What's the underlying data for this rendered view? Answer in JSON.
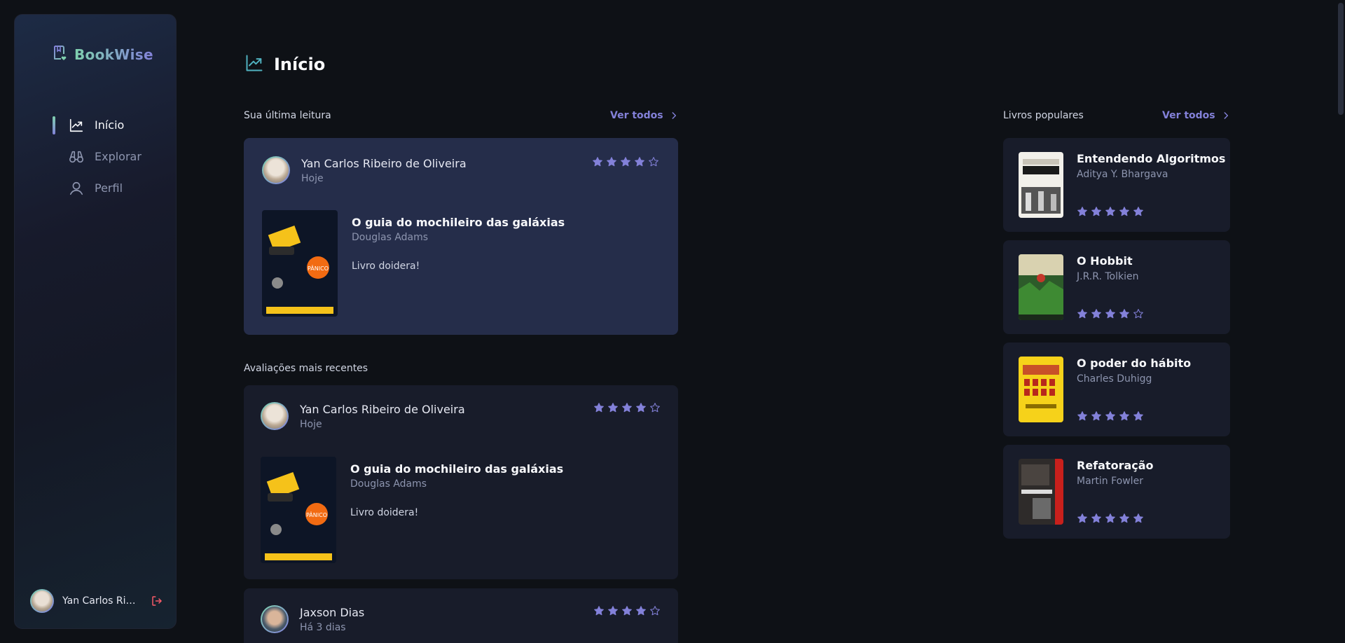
{
  "app": {
    "name": "BookWise"
  },
  "sidebar": {
    "items": [
      {
        "label": "Início",
        "icon": "chart-line-up-icon",
        "active": true
      },
      {
        "label": "Explorar",
        "icon": "binoculars-icon",
        "active": false
      },
      {
        "label": "Perfil",
        "icon": "user-icon",
        "active": false
      }
    ],
    "user": {
      "name": "Yan Carlos Ribeiro de Oliveira"
    }
  },
  "page": {
    "title": "Início"
  },
  "last_read": {
    "section_label": "Sua última leitura",
    "see_all": "Ver todos",
    "card": {
      "user": "Yan Carlos Ribeiro de Oliveira",
      "when": "Hoje",
      "rating": 4,
      "book_title": "O guia do mochileiro das galáxias",
      "book_author": "Douglas Adams",
      "text": "Livro doidera!"
    }
  },
  "recent": {
    "section_label": "Avaliações mais recentes",
    "reviews": [
      {
        "user": "Yan Carlos Ribeiro de Oliveira",
        "when": "Hoje",
        "rating": 4,
        "book_title": "O guia do mochileiro das galáxias",
        "book_author": "Douglas Adams",
        "text": "Livro doidera!"
      },
      {
        "user": "Jaxson Dias",
        "when": "Há 3 dias",
        "rating": 4
      }
    ]
  },
  "popular": {
    "section_label": "Livros populares",
    "see_all": "Ver todos",
    "books": [
      {
        "title": "Entendendo Algoritmos",
        "author": "Aditya Y. Bhargava",
        "rating": 5
      },
      {
        "title": "O Hobbit",
        "author": "J.R.R. Tolkien",
        "rating": 4
      },
      {
        "title": "O poder do hábito",
        "author": "Charles Duhigg",
        "rating": 5
      },
      {
        "title": "Refatoração",
        "author": "Martin Fowler",
        "rating": 5
      }
    ]
  },
  "colors": {
    "accent": "#8381d9",
    "green": "#7fd1ae",
    "card": "#181c2a",
    "card_highlight": "#252d4a",
    "background": "#0e1116"
  }
}
